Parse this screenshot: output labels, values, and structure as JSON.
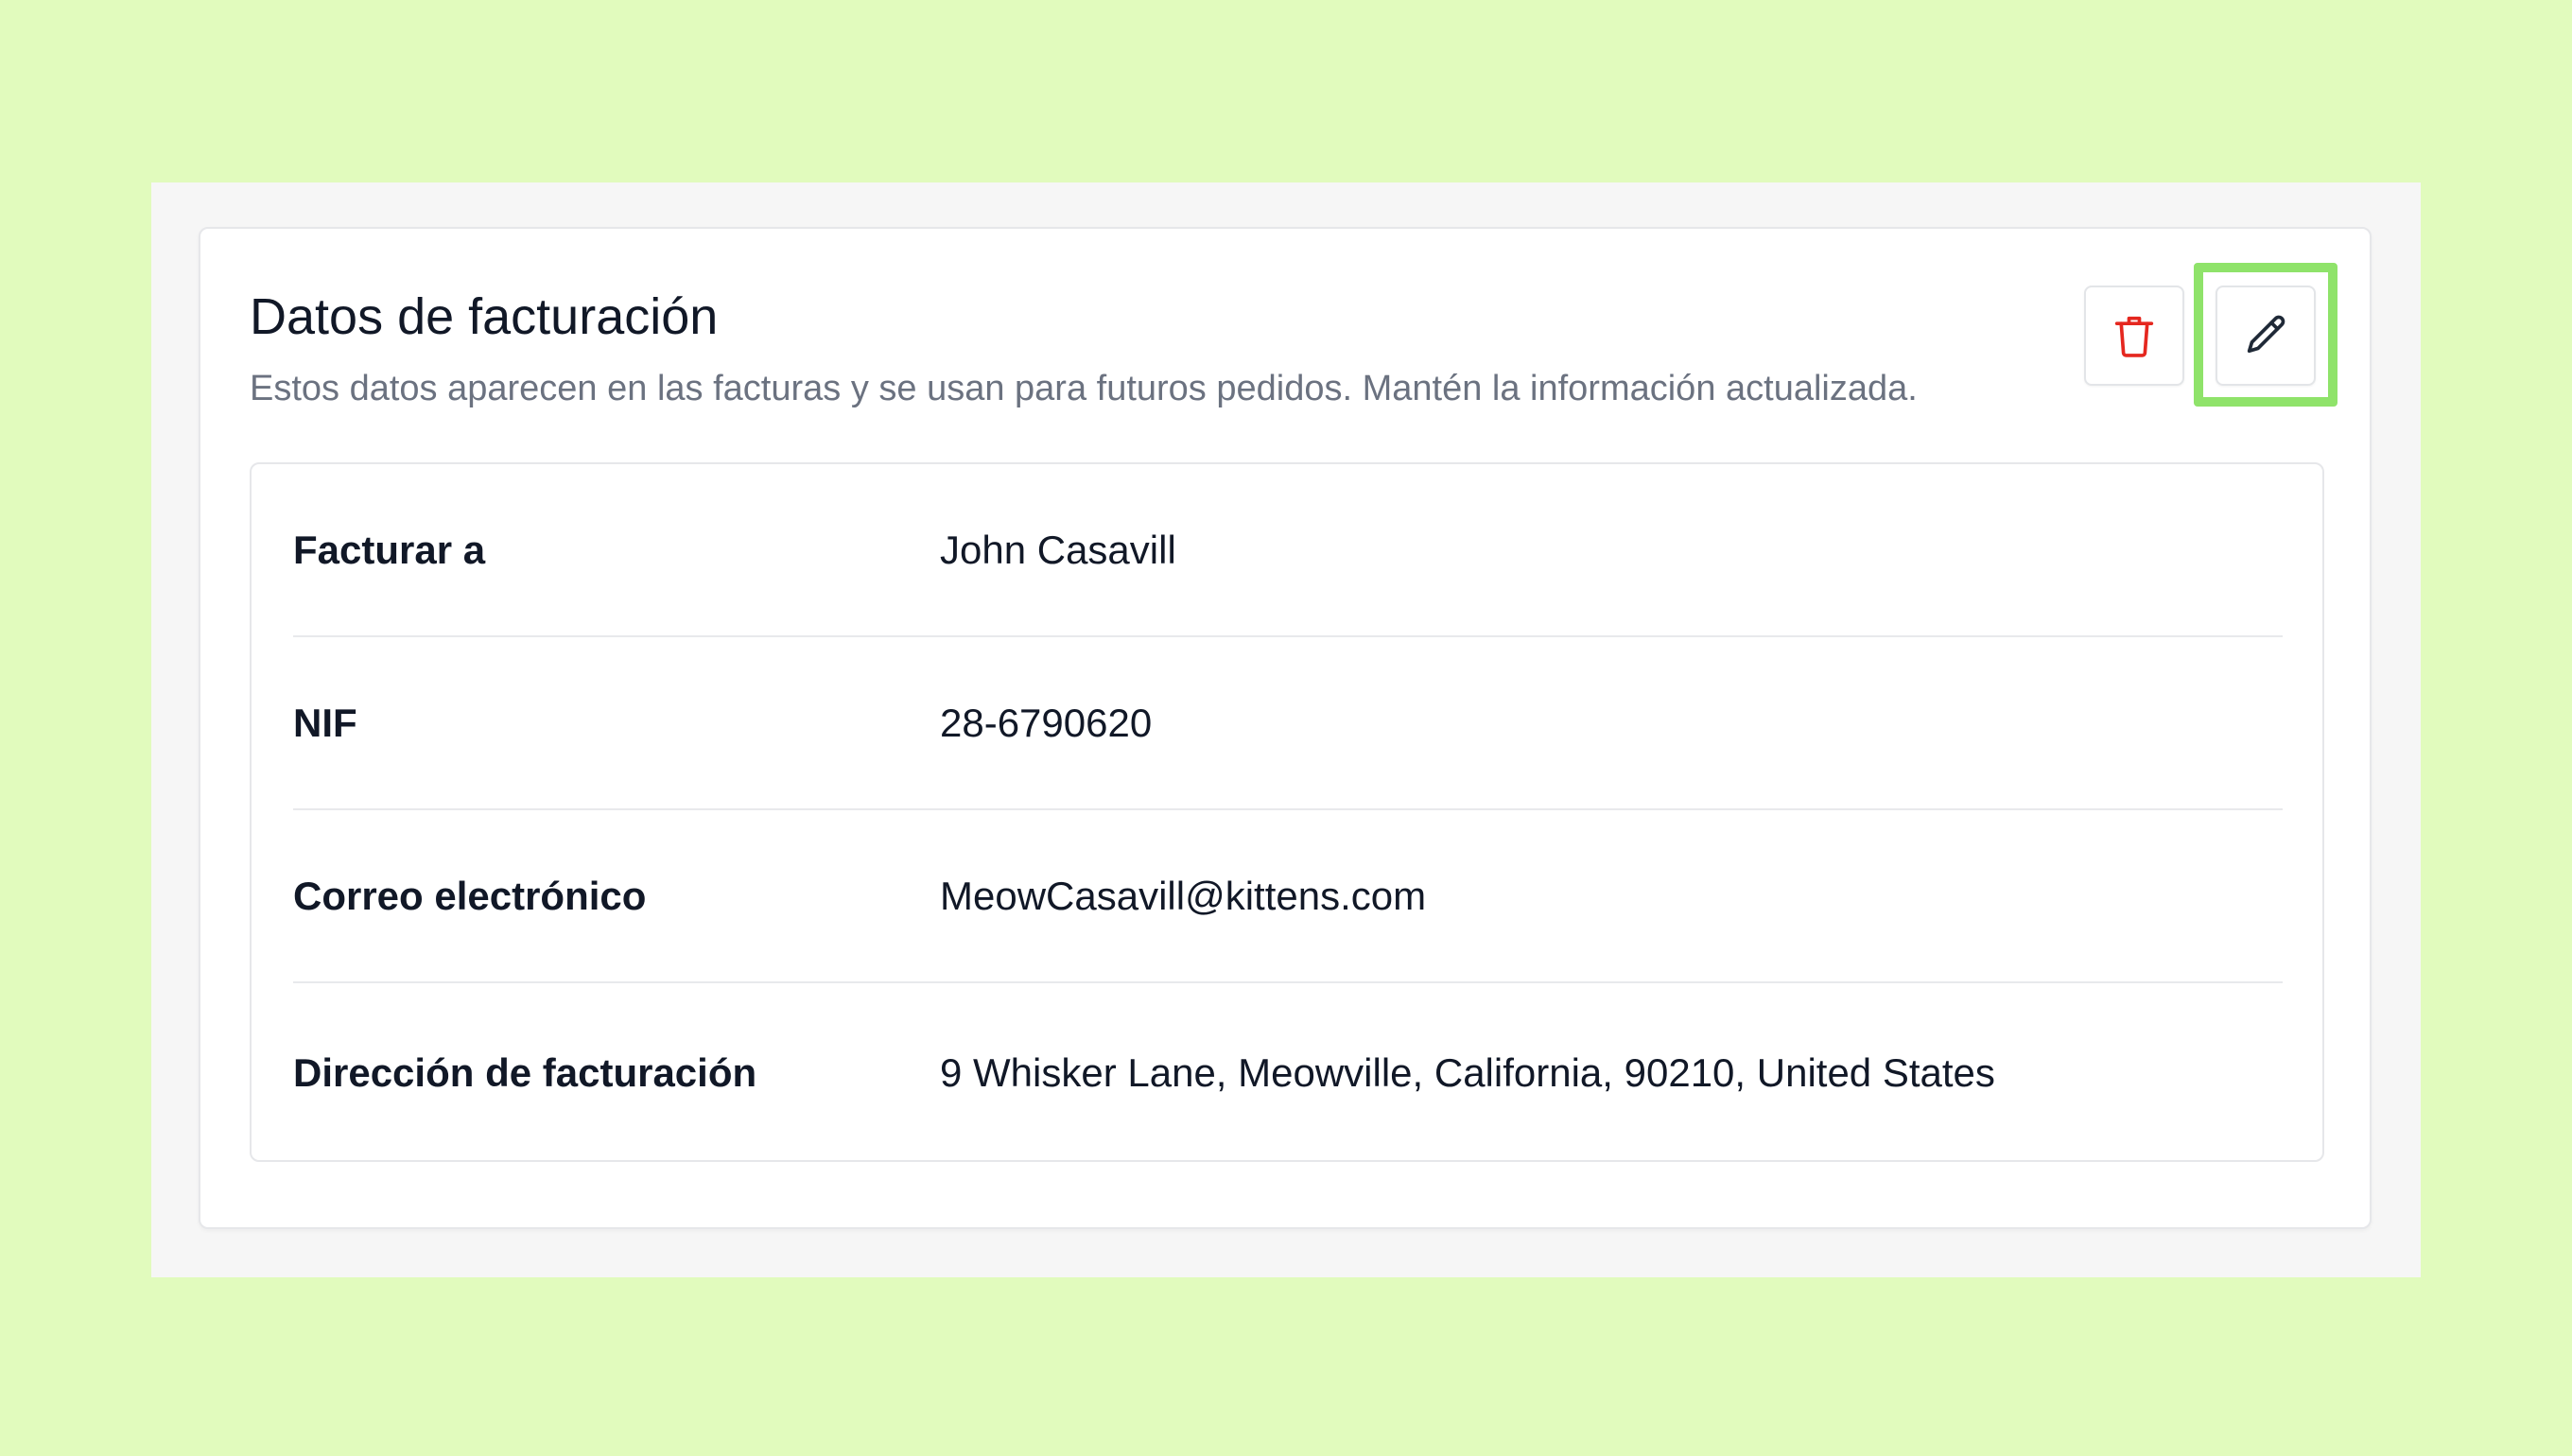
{
  "card": {
    "title": "Datos de facturación",
    "subtitle": "Estos datos aparecen en las facturas y se usan para futuros pedidos. Mantén la información actualizada."
  },
  "actions": {
    "delete_icon": "trash-icon",
    "edit_icon": "pencil-icon",
    "delete_color": "#e5271f",
    "highlight_color": "#8fe36a"
  },
  "rows": [
    {
      "label": "Facturar a",
      "value": "John Casavill"
    },
    {
      "label": "NIF",
      "value": "28-6790620"
    },
    {
      "label": "Correo electrónico",
      "value": "MeowCasavill@kittens.com"
    },
    {
      "label": "Dirección de facturación",
      "value": "9 Whisker Lane, Meowville, California, 90210, United States"
    }
  ]
}
